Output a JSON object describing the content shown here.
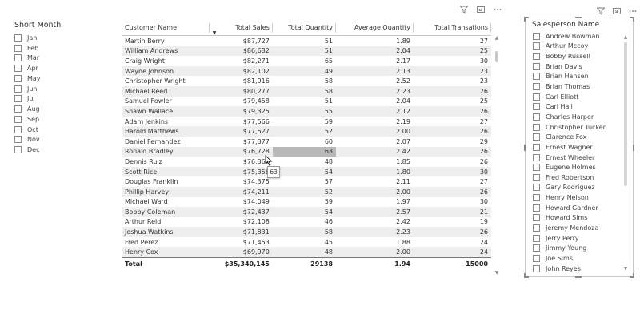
{
  "month_slicer": {
    "title": "Short Month",
    "items": [
      "Jan",
      "Feb",
      "Mar",
      "Apr",
      "May",
      "Jun",
      "Jul",
      "Aug",
      "Sep",
      "Oct",
      "Nov",
      "Dec"
    ]
  },
  "visual_header_icons": [
    "filter-icon",
    "focus-mode-icon",
    "more-options-icon"
  ],
  "table": {
    "columns": [
      "Customer Name",
      "Total Sales",
      "Total Quantity",
      "Average Quantity",
      "Total Transations"
    ],
    "sorted_column": "Total Sales",
    "rows": [
      [
        "Martin Berry",
        "$87,727",
        "51",
        "1.89",
        "27"
      ],
      [
        "William Andrews",
        "$86,682",
        "51",
        "2.04",
        "25"
      ],
      [
        "Craig Wright",
        "$82,271",
        "65",
        "2.17",
        "30"
      ],
      [
        "Wayne Johnson",
        "$82,102",
        "49",
        "2.13",
        "23"
      ],
      [
        "Christopher Wright",
        "$81,916",
        "58",
        "2.52",
        "23"
      ],
      [
        "Michael Reed",
        "$80,277",
        "58",
        "2.23",
        "26"
      ],
      [
        "Samuel Fowler",
        "$79,458",
        "51",
        "2.04",
        "25"
      ],
      [
        "Shawn Wallace",
        "$79,325",
        "55",
        "2.12",
        "26"
      ],
      [
        "Adam Jenkins",
        "$77,566",
        "59",
        "2.19",
        "27"
      ],
      [
        "Harold Matthews",
        "$77,527",
        "52",
        "2.00",
        "26"
      ],
      [
        "Daniel Fernandez",
        "$77,377",
        "60",
        "2.07",
        "29"
      ],
      [
        "Ronald Bradley",
        "$76,728",
        "63",
        "2.42",
        "26"
      ],
      [
        "Dennis Ruiz",
        "$76,367",
        "48",
        "1.85",
        "26"
      ],
      [
        "Scott Rice",
        "$75,356",
        "54",
        "1.80",
        "30"
      ],
      [
        "Douglas Franklin",
        "$74,375",
        "57",
        "2.11",
        "27"
      ],
      [
        "Phillip Harvey",
        "$74,211",
        "52",
        "2.00",
        "26"
      ],
      [
        "Michael Ward",
        "$74,049",
        "59",
        "1.97",
        "30"
      ],
      [
        "Bobby Coleman",
        "$72,437",
        "54",
        "2.57",
        "21"
      ],
      [
        "Arthur Reid",
        "$72,108",
        "46",
        "2.42",
        "19"
      ],
      [
        "Joshua Watkins",
        "$71,831",
        "58",
        "2.23",
        "26"
      ],
      [
        "Fred Perez",
        "$71,453",
        "45",
        "1.88",
        "24"
      ],
      [
        "Henry Cox",
        "$69,970",
        "48",
        "2.00",
        "24"
      ]
    ],
    "total": [
      "Total",
      "$35,340,145",
      "29138",
      "1.94",
      "15000"
    ],
    "hovered_row_index": 11,
    "hovered_col_index": 2,
    "tooltip_value": "63"
  },
  "salesperson_slicer": {
    "title": "Salesperson Name",
    "items": [
      "Andrew Bowman",
      "Arthur Mccoy",
      "Bobby Russell",
      "Brian Davis",
      "Brian Hansen",
      "Brian Thomas",
      "Carl Elliott",
      "Carl Hall",
      "Charles Harper",
      "Christopher Tucker",
      "Clarence Fox",
      "Ernest Wagner",
      "Ernest Wheeler",
      "Eugene Holmes",
      "Fred Robertson",
      "Gary Rodriguez",
      "Henry Nelson",
      "Howard Gardner",
      "Howard Sims",
      "Jeremy Mendoza",
      "Jerry Perry",
      "Jimmy Young",
      "Joe Sims",
      "John Reyes"
    ]
  },
  "colors": {
    "alt_row": "#eeeeee",
    "hover_cell": "#b9b9b9",
    "border": "#c8c8c8"
  }
}
